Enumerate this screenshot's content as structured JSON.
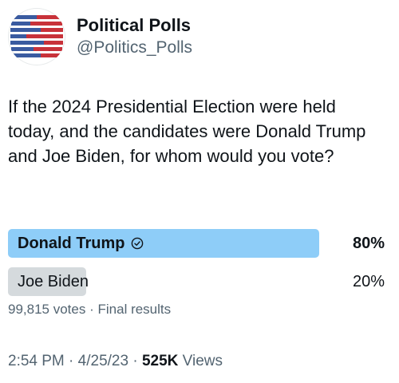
{
  "account": {
    "display_name": "Political Polls",
    "handle": "@Politics_Polls",
    "avatar_icon": "flag-stripes-logo"
  },
  "tweet": {
    "text": "If the 2024 Presidential Election were held today, and the candidates were Donald Trump and Joe Biden, for whom would you vote?"
  },
  "poll": {
    "options": [
      {
        "label": "Donald Trump",
        "percent_text": "80%",
        "percent": 80,
        "winner": true,
        "icon": "check-circle-icon"
      },
      {
        "label": "Joe Biden",
        "percent_text": "20%",
        "percent": 20,
        "winner": false
      }
    ],
    "votes": "99,815 votes",
    "separator": "·",
    "status": "Final results"
  },
  "footer": {
    "time": "2:54 PM",
    "sep1": "·",
    "date": "4/25/23",
    "sep2": "·",
    "views_count": "525K",
    "views_label": "Views"
  },
  "colors": {
    "winner_bar": "#8ecdf8",
    "loser_bar": "#d5dadd",
    "text_primary": "#0f1419",
    "text_secondary": "#536471",
    "flag_red": "#c8323a",
    "flag_blue": "#3a5ba0"
  }
}
